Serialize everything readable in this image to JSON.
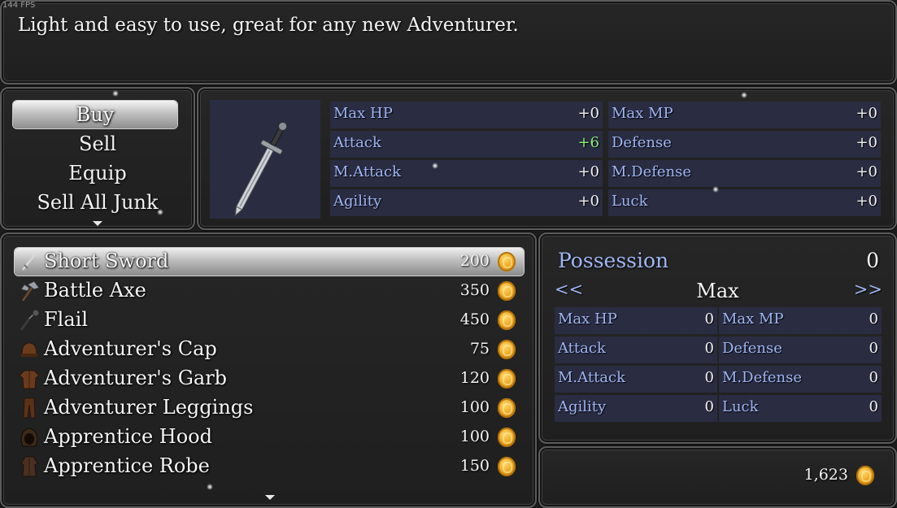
{
  "fps": "144 FPS",
  "help": {
    "text": "Light and easy to use, great for any new Adventurer."
  },
  "commands": [
    {
      "label": "Buy",
      "selected": true
    },
    {
      "label": "Sell",
      "selected": false
    },
    {
      "label": "Equip",
      "selected": false
    },
    {
      "label": "Sell All Junk",
      "selected": false
    }
  ],
  "preview": {
    "icon": "short-sword-icon",
    "stats": [
      {
        "label": "Max HP",
        "value": "+0"
      },
      {
        "label": "Max MP",
        "value": "+0"
      },
      {
        "label": "Attack",
        "value": "+6"
      },
      {
        "label": "Defense",
        "value": "+0"
      },
      {
        "label": "M.Attack",
        "value": "+0"
      },
      {
        "label": "M.Defense",
        "value": "+0"
      },
      {
        "label": "Agility",
        "value": "+0"
      },
      {
        "label": "Luck",
        "value": "+0"
      }
    ]
  },
  "items": [
    {
      "name": "Short Sword",
      "price": "200",
      "icon": "sword-icon",
      "selected": true
    },
    {
      "name": "Battle Axe",
      "price": "350",
      "icon": "axe-icon",
      "selected": false
    },
    {
      "name": "Flail",
      "price": "450",
      "icon": "flail-icon",
      "selected": false
    },
    {
      "name": "Adventurer's Cap",
      "price": "75",
      "icon": "cap-icon",
      "selected": false
    },
    {
      "name": "Adventurer's Garb",
      "price": "120",
      "icon": "garb-icon",
      "selected": false
    },
    {
      "name": "Adventurer Leggings",
      "price": "100",
      "icon": "leggings-icon",
      "selected": false
    },
    {
      "name": "Apprentice Hood",
      "price": "100",
      "icon": "hood-icon",
      "selected": false
    },
    {
      "name": "Apprentice Robe",
      "price": "150",
      "icon": "robe-icon",
      "selected": false
    }
  ],
  "possession": {
    "label": "Possession",
    "count": "0",
    "prev": "<<",
    "next": ">>",
    "mode": "Max",
    "stats": [
      {
        "label": "Max HP",
        "value": "0"
      },
      {
        "label": "Max MP",
        "value": "0"
      },
      {
        "label": "Attack",
        "value": "0"
      },
      {
        "label": "Defense",
        "value": "0"
      },
      {
        "label": "M.Attack",
        "value": "0"
      },
      {
        "label": "M.Defense",
        "value": "0"
      },
      {
        "label": "Agility",
        "value": "0"
      },
      {
        "label": "Luck",
        "value": "0"
      }
    ]
  },
  "gold": {
    "amount": "1,623",
    "icon": "gold-coin-icon"
  },
  "colors": {
    "stat_label": "#9fb6f4",
    "stat_bg": "#2a2c42",
    "increase": "#8af07a",
    "coin": "#e8a21e"
  }
}
